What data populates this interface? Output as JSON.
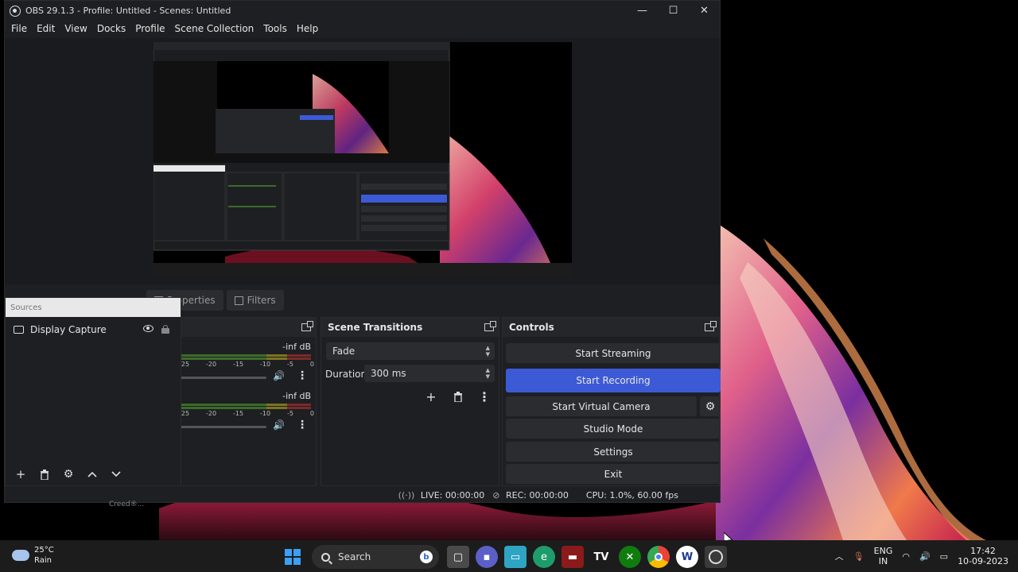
{
  "window": {
    "title": "OBS 29.1.3 - Profile: Untitled - Scenes: Untitled",
    "minimize": "—",
    "maximize": "☐",
    "close": "✕"
  },
  "menu": [
    "File",
    "Edit",
    "View",
    "Docks",
    "Profile",
    "Scene Collection",
    "Tools",
    "Help"
  ],
  "tabs": {
    "properties": "Properties",
    "filters": "Filters"
  },
  "sources": {
    "title": "Sources",
    "items": [
      {
        "name": "Display Capture"
      }
    ]
  },
  "mixer": {
    "channels": [
      {
        "db": "-inf dB"
      },
      {
        "db": "-inf dB"
      }
    ],
    "scale": [
      "-25",
      "-20",
      "-15",
      "-10",
      "-5",
      "0"
    ]
  },
  "transitions": {
    "title": "Scene Transitions",
    "selected": "Fade",
    "duration_label": "Duration",
    "duration_value": "300 ms"
  },
  "controls": {
    "title": "Controls",
    "start_streaming": "Start Streaming",
    "start_recording": "Start Recording",
    "start_virtual_camera": "Start Virtual Camera",
    "studio_mode": "Studio Mode",
    "settings": "Settings",
    "exit": "Exit"
  },
  "status": {
    "live": "LIVE: 00:00:00",
    "rec": "REC: 00:00:00",
    "cpu": "CPU: 1.0%, 60.00 fps"
  },
  "desktop_label": "Creed®...",
  "taskbar": {
    "weather_temp": "25°C",
    "weather_desc": "Rain",
    "search_label": "Search",
    "lang_top": "ENG",
    "lang_bottom": "IN",
    "time": "17:42",
    "date": "10-09-2023"
  },
  "colors": {
    "accent": "#3c5ad6",
    "panel": "#1e1f22"
  }
}
